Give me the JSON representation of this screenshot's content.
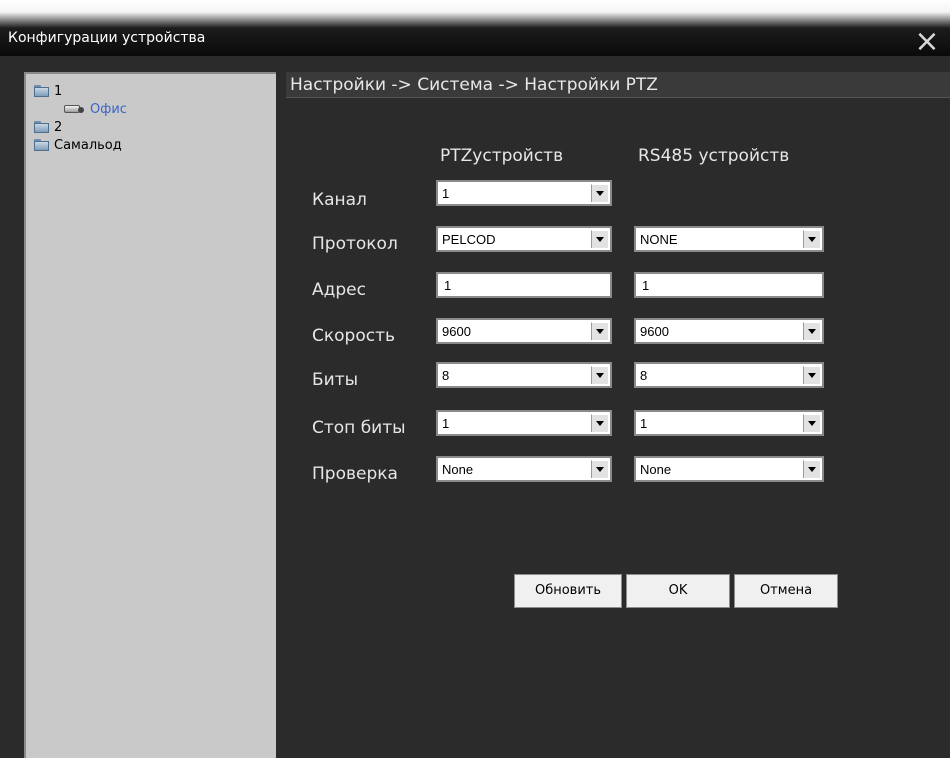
{
  "window": {
    "title": "Конфигурации устройства",
    "close_icon": "×"
  },
  "tree": [
    {
      "label": "1",
      "icon": "folder-icon"
    },
    {
      "label": "Офис",
      "icon": "camera-icon",
      "active": true
    },
    {
      "label": "2",
      "icon": "folder-icon"
    },
    {
      "label": "Самальод",
      "icon": "folder-icon"
    }
  ],
  "breadcrumb": "Настройки -> Система -> Настройки PTZ",
  "columns": {
    "ptz": "PTZустройств",
    "rs485": "RS485 устройств"
  },
  "rows": {
    "channel": {
      "label": "Канал",
      "ptz": "1"
    },
    "protocol": {
      "label": "Протокол",
      "ptz": "PELCOD",
      "rs485": "NONE"
    },
    "address": {
      "label": "Адрес",
      "ptz": "1",
      "rs485": "1"
    },
    "speed": {
      "label": "Скорость",
      "ptz": "9600",
      "rs485": "9600"
    },
    "bits": {
      "label": "Биты",
      "ptz": "8",
      "rs485": "8"
    },
    "stopbits": {
      "label": "Стоп биты",
      "ptz": "1",
      "rs485": "1"
    },
    "parity": {
      "label": "Проверка",
      "ptz": "None",
      "rs485": "None"
    }
  },
  "buttons": {
    "refresh": "Обновить",
    "ok": "OK",
    "cancel": "Отмена"
  },
  "colors": {
    "link_active": "#3a66c8",
    "panel_bg": "#2b2b2b",
    "tree_bg": "#c9c9c9"
  }
}
